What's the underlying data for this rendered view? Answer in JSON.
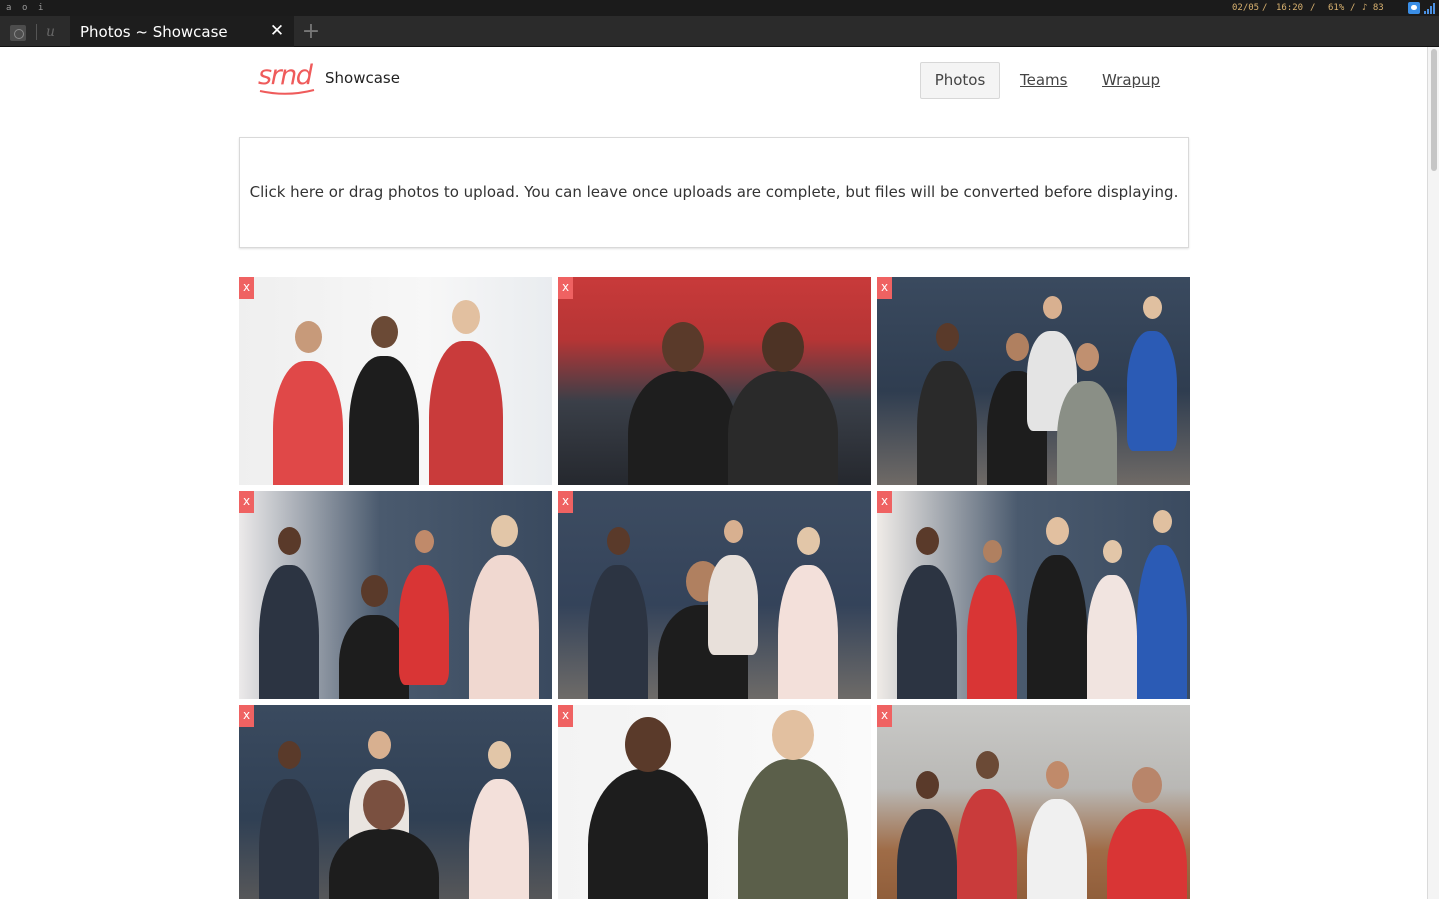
{
  "os_bar": {
    "workspaces": [
      "a",
      "o",
      "i"
    ],
    "date": "02/05",
    "time": "16:20",
    "battery": "61%",
    "volume": "♪ 83",
    "separator": "/"
  },
  "browser": {
    "tab_title": "Photos ~ Showcase",
    "tab_close": "✕",
    "new_tab": "+"
  },
  "header": {
    "logo_text": "srnd",
    "site_name": "Showcase",
    "nav": {
      "photos": "Photos",
      "teams": "Teams",
      "wrapup": "Wrapup"
    }
  },
  "upload": {
    "text": "Click here or drag photos to upload. You can leave once uploads are complete, but files will be converted before displaying."
  },
  "photos": {
    "delete_label": "x",
    "count": 9
  },
  "colors": {
    "brand": "#ef5b5b",
    "delete_badge": "#ef6262",
    "tab_bar": "#2b2b2b",
    "status_bar": "#1b1b1b"
  }
}
